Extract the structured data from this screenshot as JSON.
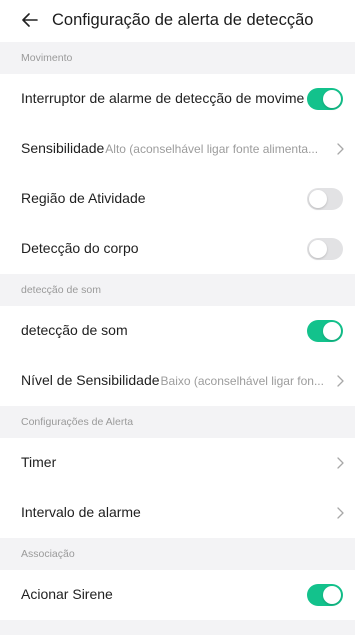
{
  "header": {
    "title": "Configuração de alerta de detecção"
  },
  "sections": {
    "movimento": "Movimento",
    "som": "detecção de som",
    "alerta": "Configurações de Alerta",
    "associacao": "Associação"
  },
  "rows": {
    "interruptor": {
      "label": "Interruptor de alarme de detecção de movime",
      "toggle": true
    },
    "sensibilidade": {
      "label": "Sensibilidade",
      "value": "Alto (aconselhável ligar fonte alimenta..."
    },
    "regiao": {
      "label": "Região de Atividade",
      "toggle": false
    },
    "corpo": {
      "label": "Detecção do corpo",
      "toggle": false
    },
    "som": {
      "label": "detecção de som",
      "toggle": true
    },
    "nivel": {
      "label": "Nível de Sensibilidade",
      "value": "Baixo (aconselhável ligar fon..."
    },
    "timer": {
      "label": "Timer"
    },
    "intervalo": {
      "label": "Intervalo de alarme"
    },
    "sirene": {
      "label": "Acionar Sirene",
      "toggle": true
    }
  },
  "colors": {
    "toggle_on": "#13c28c",
    "toggle_off": "#e2e2e4",
    "section_bg": "#f3f3f5"
  },
  "icons": {
    "back": "arrow-left-icon",
    "chevron": "chevron-right-icon"
  }
}
